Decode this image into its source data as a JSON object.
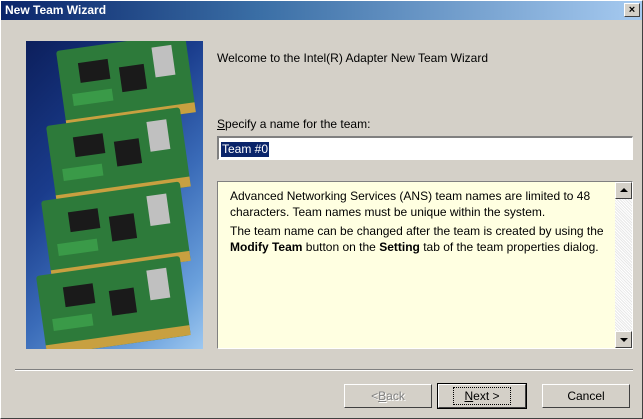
{
  "window": {
    "title": "New Team Wizard",
    "close_glyph": "×"
  },
  "banner": {
    "icon": "network-adapter-cards-icon"
  },
  "content": {
    "welcome": "Welcome to the Intel(R) Adapter New Team Wizard",
    "name_label_access": "S",
    "name_label_rest": "pecify a name for the team:",
    "name_value": "Team #0",
    "info_paragraph_1": "Advanced Networking Services (ANS) team names are limited to 48 characters. Team names must be unique within the system.",
    "info_p2_a": "The team name can be changed after the team is created by using the ",
    "info_p2_bold1": "Modify Team",
    "info_p2_b": " button on the ",
    "info_p2_bold2": "Setting",
    "info_p2_c": " tab of the team properties dialog."
  },
  "buttons": {
    "back_prefix": "< ",
    "back_access": "B",
    "back_rest": "ack",
    "next_access": "N",
    "next_rest": "ext >",
    "cancel": "Cancel"
  },
  "colors": {
    "title_gradient_start": "#0a246a",
    "dialog_background": "#d4d0c8",
    "info_background": "#ffffe1",
    "selection": "#0a246a"
  }
}
